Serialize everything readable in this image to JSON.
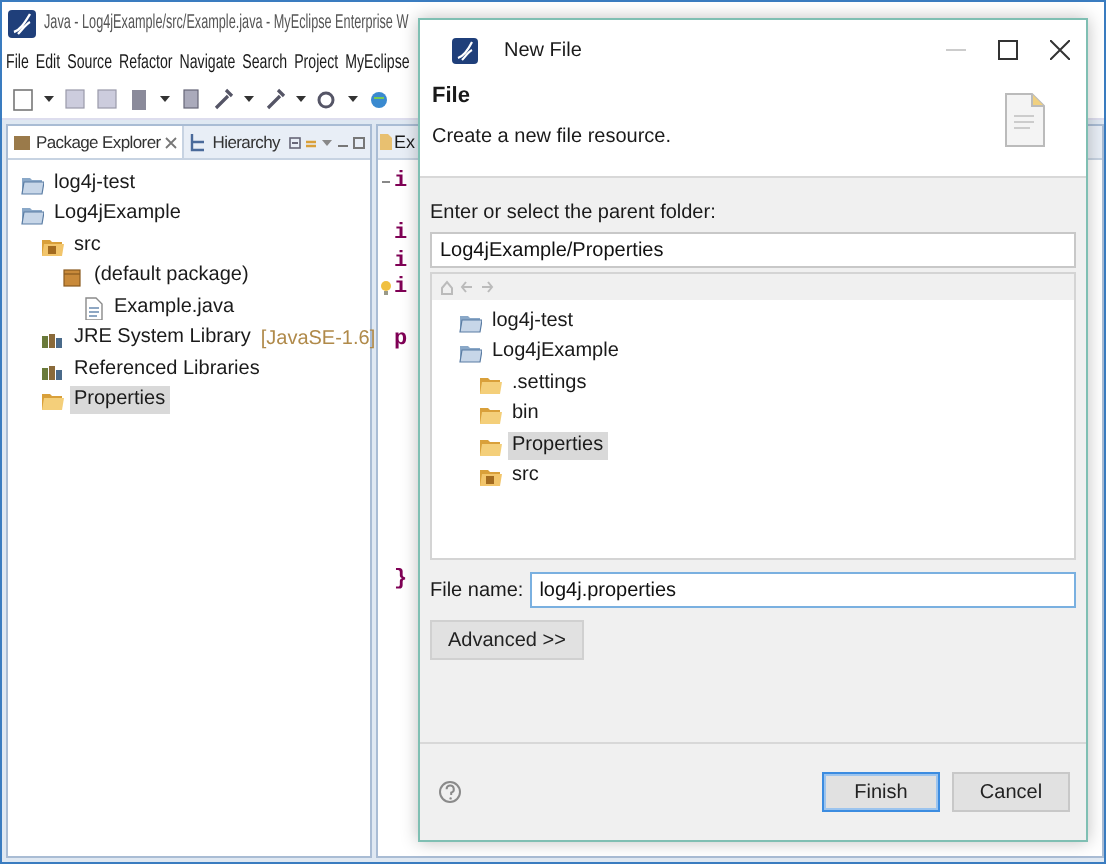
{
  "window": {
    "title": "Java - Log4jExample/src/Example.java - MyEclipse Enterprise W"
  },
  "menu": [
    "File",
    "Edit",
    "Source",
    "Refactor",
    "Navigate",
    "Search",
    "Project",
    "MyEclipse"
  ],
  "explorer": {
    "tabs": [
      {
        "label": "Package Explorer",
        "selected": true
      },
      {
        "label": "Hierarchy",
        "selected": false
      }
    ],
    "items": [
      {
        "label": "log4j-test",
        "kind": "project",
        "selected": false
      },
      {
        "label": "Log4jExample",
        "kind": "project",
        "selected": false,
        "children": [
          {
            "label": "src",
            "kind": "source-folder",
            "selected": false,
            "children": [
              {
                "label": "(default package)",
                "kind": "package",
                "selected": false,
                "children": [
                  {
                    "label": "Example.java",
                    "kind": "java-file",
                    "selected": false
                  }
                ]
              }
            ]
          },
          {
            "label": "JRE System Library",
            "decoration": "[JavaSE-1.6]",
            "kind": "library",
            "selected": false
          },
          {
            "label": "Referenced Libraries",
            "kind": "library",
            "selected": false
          },
          {
            "label": "Properties",
            "kind": "folder",
            "selected": true
          }
        ]
      }
    ]
  },
  "editor": {
    "tab": "Ex",
    "lines": [
      {
        "kind": "fold",
        "text": "i"
      },
      {
        "kind": "blank"
      },
      {
        "kind": "code",
        "text": "i"
      },
      {
        "kind": "code",
        "text": "i"
      },
      {
        "kind": "warning",
        "text": "i"
      },
      {
        "kind": "blank"
      },
      {
        "kind": "code",
        "text": "p"
      },
      {
        "kind": "blank"
      },
      {
        "kind": "blank"
      },
      {
        "kind": "blank"
      },
      {
        "kind": "blank"
      },
      {
        "kind": "blank"
      },
      {
        "kind": "blank"
      },
      {
        "kind": "blank"
      },
      {
        "kind": "blank"
      },
      {
        "kind": "code",
        "text": "}"
      }
    ]
  },
  "dialog": {
    "title": "New File",
    "heading": "File",
    "description": "Create a new file resource.",
    "folder_label": "Enter or select the parent folder:",
    "folder_value": "Log4jExample/Properties",
    "folder_tree": [
      {
        "label": "log4j-test",
        "kind": "project",
        "selected": false
      },
      {
        "label": "Log4jExample",
        "kind": "project",
        "selected": false,
        "children": [
          {
            "label": ".settings",
            "kind": "folder",
            "selected": false
          },
          {
            "label": "bin",
            "kind": "folder",
            "selected": false
          },
          {
            "label": "Properties",
            "kind": "folder",
            "selected": true
          },
          {
            "label": "src",
            "kind": "source-folder",
            "selected": false
          }
        ]
      }
    ],
    "file_name_label": "File name:",
    "file_name_value": "log4j.properties",
    "advanced_button": "Advanced >>",
    "buttons": [
      {
        "label": "Finish",
        "default": true
      },
      {
        "label": "Cancel",
        "default": false
      }
    ]
  }
}
